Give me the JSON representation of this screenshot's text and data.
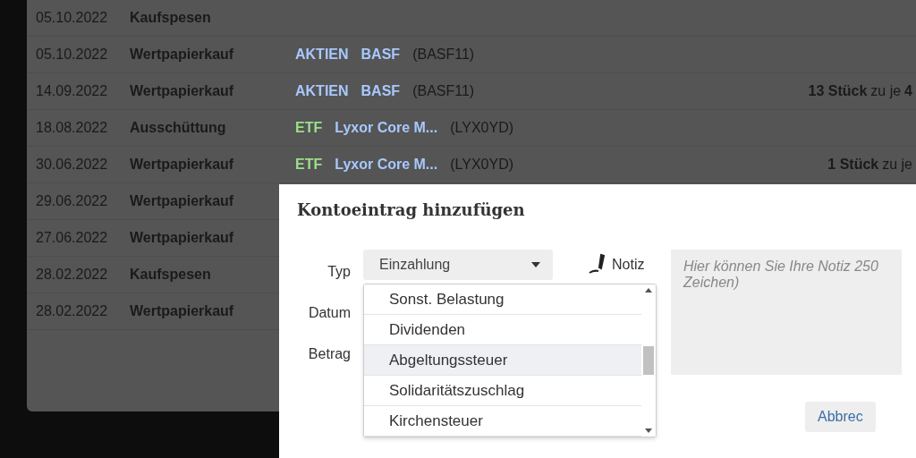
{
  "transactions": [
    {
      "date": "05.10.2022",
      "type": "Kaufspesen"
    },
    {
      "date": "05.10.2022",
      "type": "Wertpapierkauf",
      "asset": {
        "kind": "aktie",
        "category": "AKTIEN",
        "name": "BASF",
        "code": "(BASF11)"
      }
    },
    {
      "date": "14.09.2022",
      "type": "Wertpapierkauf",
      "asset": {
        "kind": "aktie",
        "category": "AKTIEN",
        "name": "BASF",
        "code": "(BASF11)"
      },
      "quantity": "13 Stück",
      "price": "zu je",
      "price_value": "4"
    },
    {
      "date": "18.08.2022",
      "type": "Ausschüttung",
      "asset": {
        "kind": "etf",
        "category": "ETF",
        "name": "Lyxor Core M...",
        "code": "(LYX0YD)"
      }
    },
    {
      "date": "30.06.2022",
      "type": "Wertpapierkauf",
      "asset": {
        "kind": "etf",
        "category": "ETF",
        "name": "Lyxor Core M...",
        "code": "(LYX0YD)"
      },
      "quantity": "1 Stück",
      "price": "zu je"
    },
    {
      "date": "29.06.2022",
      "type": "Wertpapierkauf"
    },
    {
      "date": "27.06.2022",
      "type": "Wertpapierkauf"
    },
    {
      "date": "28.02.2022",
      "type": "Kaufspesen"
    },
    {
      "date": "28.02.2022",
      "type": "Wertpapierkauf"
    }
  ],
  "dialog": {
    "title": "Kontoeintrag hinzufügen",
    "labels": {
      "type": "Typ",
      "date": "Datum",
      "amount": "Betrag",
      "note": "Notiz"
    },
    "type_select": {
      "value": "Einzahlung",
      "expanded": true,
      "options": [
        {
          "label": "Sonst. Belastung",
          "highlighted": false
        },
        {
          "label": "Dividenden",
          "highlighted": false
        },
        {
          "label": "Abgeltungssteuer",
          "highlighted": true
        },
        {
          "label": "Solidaritätszuschlag",
          "highlighted": false
        },
        {
          "label": "Kirchensteuer",
          "highlighted": false
        }
      ]
    },
    "note": {
      "placeholder": "Hier können Sie Ihre Notiz 250 Zeichen)"
    },
    "cancel_button": "Abbrec"
  }
}
